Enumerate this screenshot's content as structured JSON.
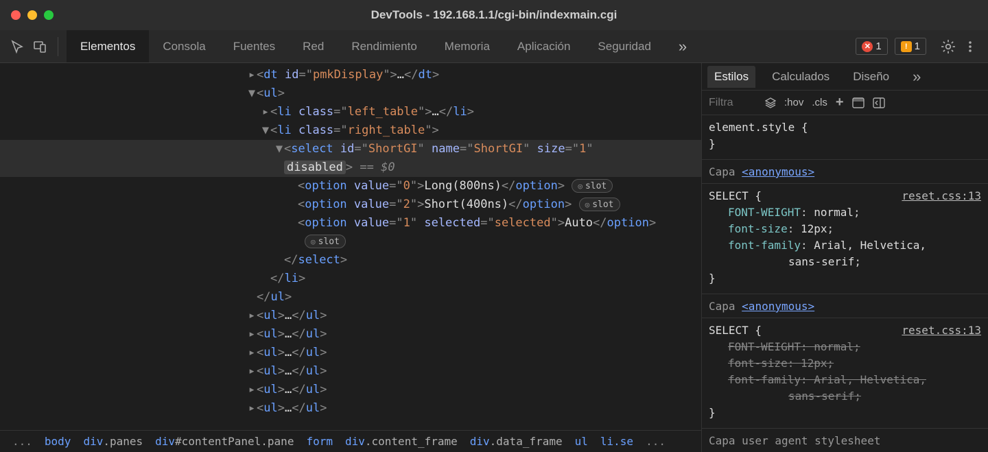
{
  "window": {
    "title": "DevTools - 192.168.1.1/cgi-bin/indexmain.cgi"
  },
  "tabs": {
    "elements": "Elementos",
    "console": "Consola",
    "sources": "Fuentes",
    "network": "Red",
    "performance": "Rendimiento",
    "memory": "Memoria",
    "application": "Aplicación",
    "security": "Seguridad"
  },
  "badges": {
    "errors": "1",
    "warnings": "1"
  },
  "dom": {
    "dt_line": "<dt id=\"pmkDisplay\">…</dt>",
    "ul_open": "ul",
    "li_left_ellipsis": "…",
    "li_left_class": "left_table",
    "li_right_class": "right_table",
    "select_id": "ShortGI",
    "select_name": "ShortGI",
    "select_size": "1",
    "select_disabled": "disabled",
    "selected_ref": " == $0",
    "opt0_val": "0",
    "opt0_text": "Long(800ns)",
    "opt2_val": "2",
    "opt2_text": "Short(400ns)",
    "opt1_val": "1",
    "opt1_sel": "selected",
    "opt1_text": "Auto",
    "slot": "slot",
    "ul_ellipsis": "…"
  },
  "breadcrumb": {
    "b0": "...",
    "b1": "body",
    "b2_tag": "div",
    "b2_cls": ".panes",
    "b3_tag": "div",
    "b3_id": "#contentPanel",
    "b3_cls": ".pane",
    "b4": "form",
    "b5_tag": "div",
    "b5_cls": ".content_frame",
    "b6_tag": "div",
    "b6_cls": ".data_frame",
    "b7": "ul",
    "b8": "li.se",
    "b9": "..."
  },
  "styles": {
    "tabs": {
      "styles": "Estilos",
      "computed": "Calculados",
      "layout": "Diseño"
    },
    "filter_ph": "Filtra",
    "hov": ":hov",
    "cls": ".cls",
    "element_style_label": "element.style {",
    "element_style_close": "}",
    "layer_label": "Capa ",
    "layer_anon": "<anonymous>",
    "rule_selector": "SELECT {",
    "rule_close": "}",
    "src": "reset.css:13",
    "p1_name": "FONT-WEIGHT",
    "p1_val": "normal",
    "p2_name": "font-size",
    "p2_val": "12px",
    "p3_name": "font-family",
    "p3_val": "Arial, Helvetica,",
    "p3_val2": "sans-serif",
    "ua_label": "Capa user agent stylesheet"
  }
}
